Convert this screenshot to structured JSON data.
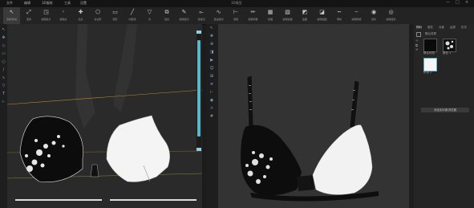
{
  "window": {
    "title": "3D模型",
    "menu": [
      "文件",
      "编辑",
      "3D服装",
      "工具",
      "设置"
    ],
    "controls": [
      "—",
      "□",
      "×"
    ]
  },
  "toolbar": {
    "tools": [
      {
        "label": "选择/移动",
        "icon": "cursor-icon"
      },
      {
        "label": "变换",
        "icon": "transform-icon"
      },
      {
        "label": "编辑版片",
        "icon": "edit-pattern-icon"
      },
      {
        "label": "编辑点",
        "icon": "edit-point-icon"
      },
      {
        "label": "加点",
        "icon": "add-point-icon"
      },
      {
        "label": "多边形",
        "icon": "polygon-icon"
      },
      {
        "label": "矩形",
        "icon": "rectangle-icon"
      },
      {
        "label": "内部线",
        "icon": "inner-line-icon"
      },
      {
        "label": "省",
        "icon": "dart-icon"
      },
      {
        "label": "缝纫",
        "icon": "sew-icon"
      },
      {
        "label": "编辑缝纫",
        "icon": "edit-sewing-icon"
      },
      {
        "label": "线缝纫",
        "icon": "segment-sew-icon"
      },
      {
        "label": "自由缝纫",
        "icon": "free-sew-icon"
      },
      {
        "label": "测量",
        "icon": "measure-icon"
      },
      {
        "label": "编辑测量",
        "icon": "edit-measure-icon"
      },
      {
        "label": "纹理",
        "icon": "texture-icon"
      },
      {
        "label": "编辑纹理",
        "icon": "edit-texture-icon"
      },
      {
        "label": "贴图",
        "icon": "graphic-icon"
      },
      {
        "label": "编辑贴图",
        "icon": "edit-graphic-icon"
      },
      {
        "label": "明线",
        "icon": "topstitch-icon"
      },
      {
        "label": "编辑明线",
        "icon": "edit-topstitch-icon"
      },
      {
        "label": "纽扣",
        "icon": "button-icon"
      },
      {
        "label": "编辑纽扣",
        "icon": "edit-button-icon"
      }
    ]
  },
  "right_panel": {
    "tabs": [
      "物料",
      "属性",
      "对象",
      "运算",
      "历史"
    ],
    "fabric_1": "默认材质",
    "fabric_2": "蕾丝 1",
    "fabric_3": "织物 2",
    "add_button": "添加",
    "bottom_button": "添加到对象浏览器"
  },
  "colors": {
    "accent": "#5ab7c8",
    "panel_bg": "#2a2a2a",
    "viewport_bg": "#333333"
  }
}
